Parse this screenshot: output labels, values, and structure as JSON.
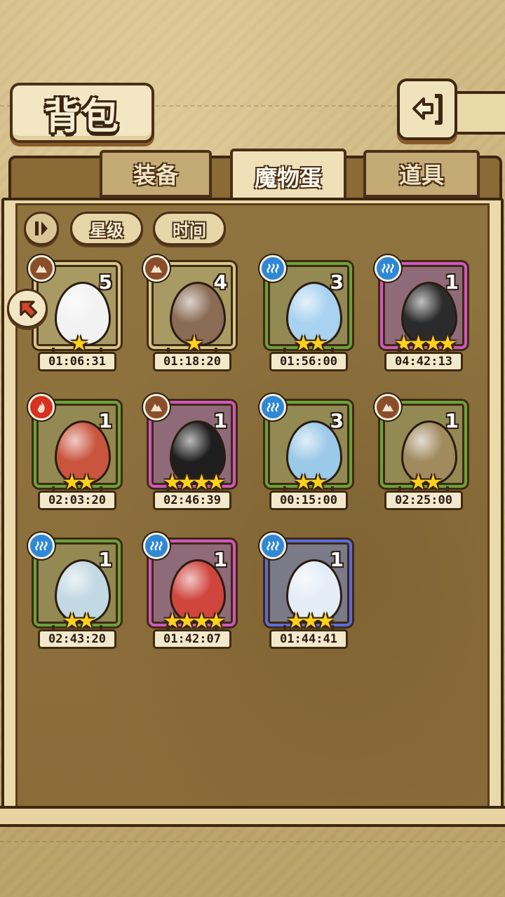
{
  "title": "背包",
  "tabs": [
    {
      "label": "装备",
      "active": false
    },
    {
      "label": "魔物蛋",
      "active": true
    },
    {
      "label": "道具",
      "active": false
    }
  ],
  "sort": {
    "buttons": [
      "星级",
      "时间"
    ]
  },
  "eggs": [
    {
      "element": "earth",
      "count": "5",
      "stars": 1,
      "rarity": 1,
      "timer": "01:06:31",
      "color": "#f2f2f2"
    },
    {
      "element": "earth",
      "count": "4",
      "stars": 1,
      "rarity": 1,
      "timer": "01:18:20",
      "color": "#8a6b55"
    },
    {
      "element": "water",
      "count": "3",
      "stars": 2,
      "rarity": 2,
      "timer": "01:56:00",
      "color": "#a8d2f0"
    },
    {
      "element": "water",
      "count": "1",
      "stars": 4,
      "rarity": 4,
      "timer": "04:42:13",
      "color": "#2b2b2b"
    },
    {
      "element": "fire",
      "count": "1",
      "stars": 2,
      "rarity": 2,
      "timer": "02:03:20",
      "color": "#c9553f"
    },
    {
      "element": "earth",
      "count": "1",
      "stars": 4,
      "rarity": 4,
      "timer": "02:46:39",
      "color": "#1e1e1e"
    },
    {
      "element": "water",
      "count": "3",
      "stars": 2,
      "rarity": 2,
      "timer": "00:15:00",
      "color": "#9bc9e8"
    },
    {
      "element": "earth",
      "count": "1",
      "stars": 2,
      "rarity": 2,
      "timer": "02:25:00",
      "color": "#a08a5e"
    },
    {
      "element": "water",
      "count": "1",
      "stars": 2,
      "rarity": 2,
      "timer": "02:43:20",
      "color": "#c2d8e2"
    },
    {
      "element": "water",
      "count": "1",
      "stars": 4,
      "rarity": 4,
      "timer": "01:42:07",
      "color": "#d0453e"
    },
    {
      "element": "water",
      "count": "1",
      "stars": 3,
      "rarity": 3,
      "timer": "01:44:41",
      "color": "#e4ecf6"
    }
  ]
}
